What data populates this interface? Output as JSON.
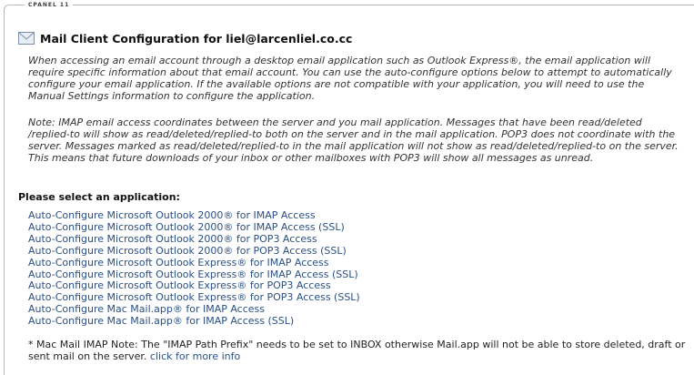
{
  "header": {
    "tab_label": "CPANEL 11"
  },
  "page": {
    "title": "Mail Client Configuration for liel@larcenliel.co.cc",
    "intro": "When accessing an email account through a desktop email application such as Outlook Express®, the email application will require specific information about that email account. You can use the auto-configure options below to attempt to automatically configure your email application. If the available options are not compatible with your application, you will need to use the Manual Settings information to configure the application.",
    "imap_note": "Note: IMAP email access coordinates between the server and you mail application. Messages that have been read/deleted /replied-to will show as read/deleted/replied-to both on the server and in the mail application. POP3 does not coordinate with the server. Messages marked as read/deleted/replied-to in the mail application will not show as read/deleted/replied-to on the server. This means that future downloads of your inbox or other mailboxes with POP3 will show all messages as unread.",
    "select_heading": "Please select an application:",
    "applications": [
      "Auto-Configure Microsoft Outlook 2000® for IMAP Access",
      "Auto-Configure Microsoft Outlook 2000® for IMAP Access (SSL)",
      "Auto-Configure Microsoft Outlook 2000® for POP3 Access",
      "Auto-Configure Microsoft Outlook 2000® for POP3 Access (SSL)",
      "Auto-Configure Microsoft Outlook Express® for IMAP Access",
      "Auto-Configure Microsoft Outlook Express® for IMAP Access (SSL)",
      "Auto-Configure Microsoft Outlook Express® for POP3 Access",
      "Auto-Configure Microsoft Outlook Express® for POP3 Access (SSL)",
      "Auto-Configure Mac Mail.app® for IMAP Access",
      "Auto-Configure Mac Mail.app® for IMAP Access (SSL)"
    ],
    "mac_note_text": "* Mac Mail IMAP Note: The \"IMAP Path Prefix\" needs to be set to INBOX otherwise Mail.app will not be able to store deleted, draft or sent mail on the server.",
    "mac_note_link": "click for more info"
  },
  "icons": {
    "title_icon": "envelope-icon"
  },
  "colors": {
    "link": "#2a4f86",
    "border": "#b9b9b9"
  }
}
